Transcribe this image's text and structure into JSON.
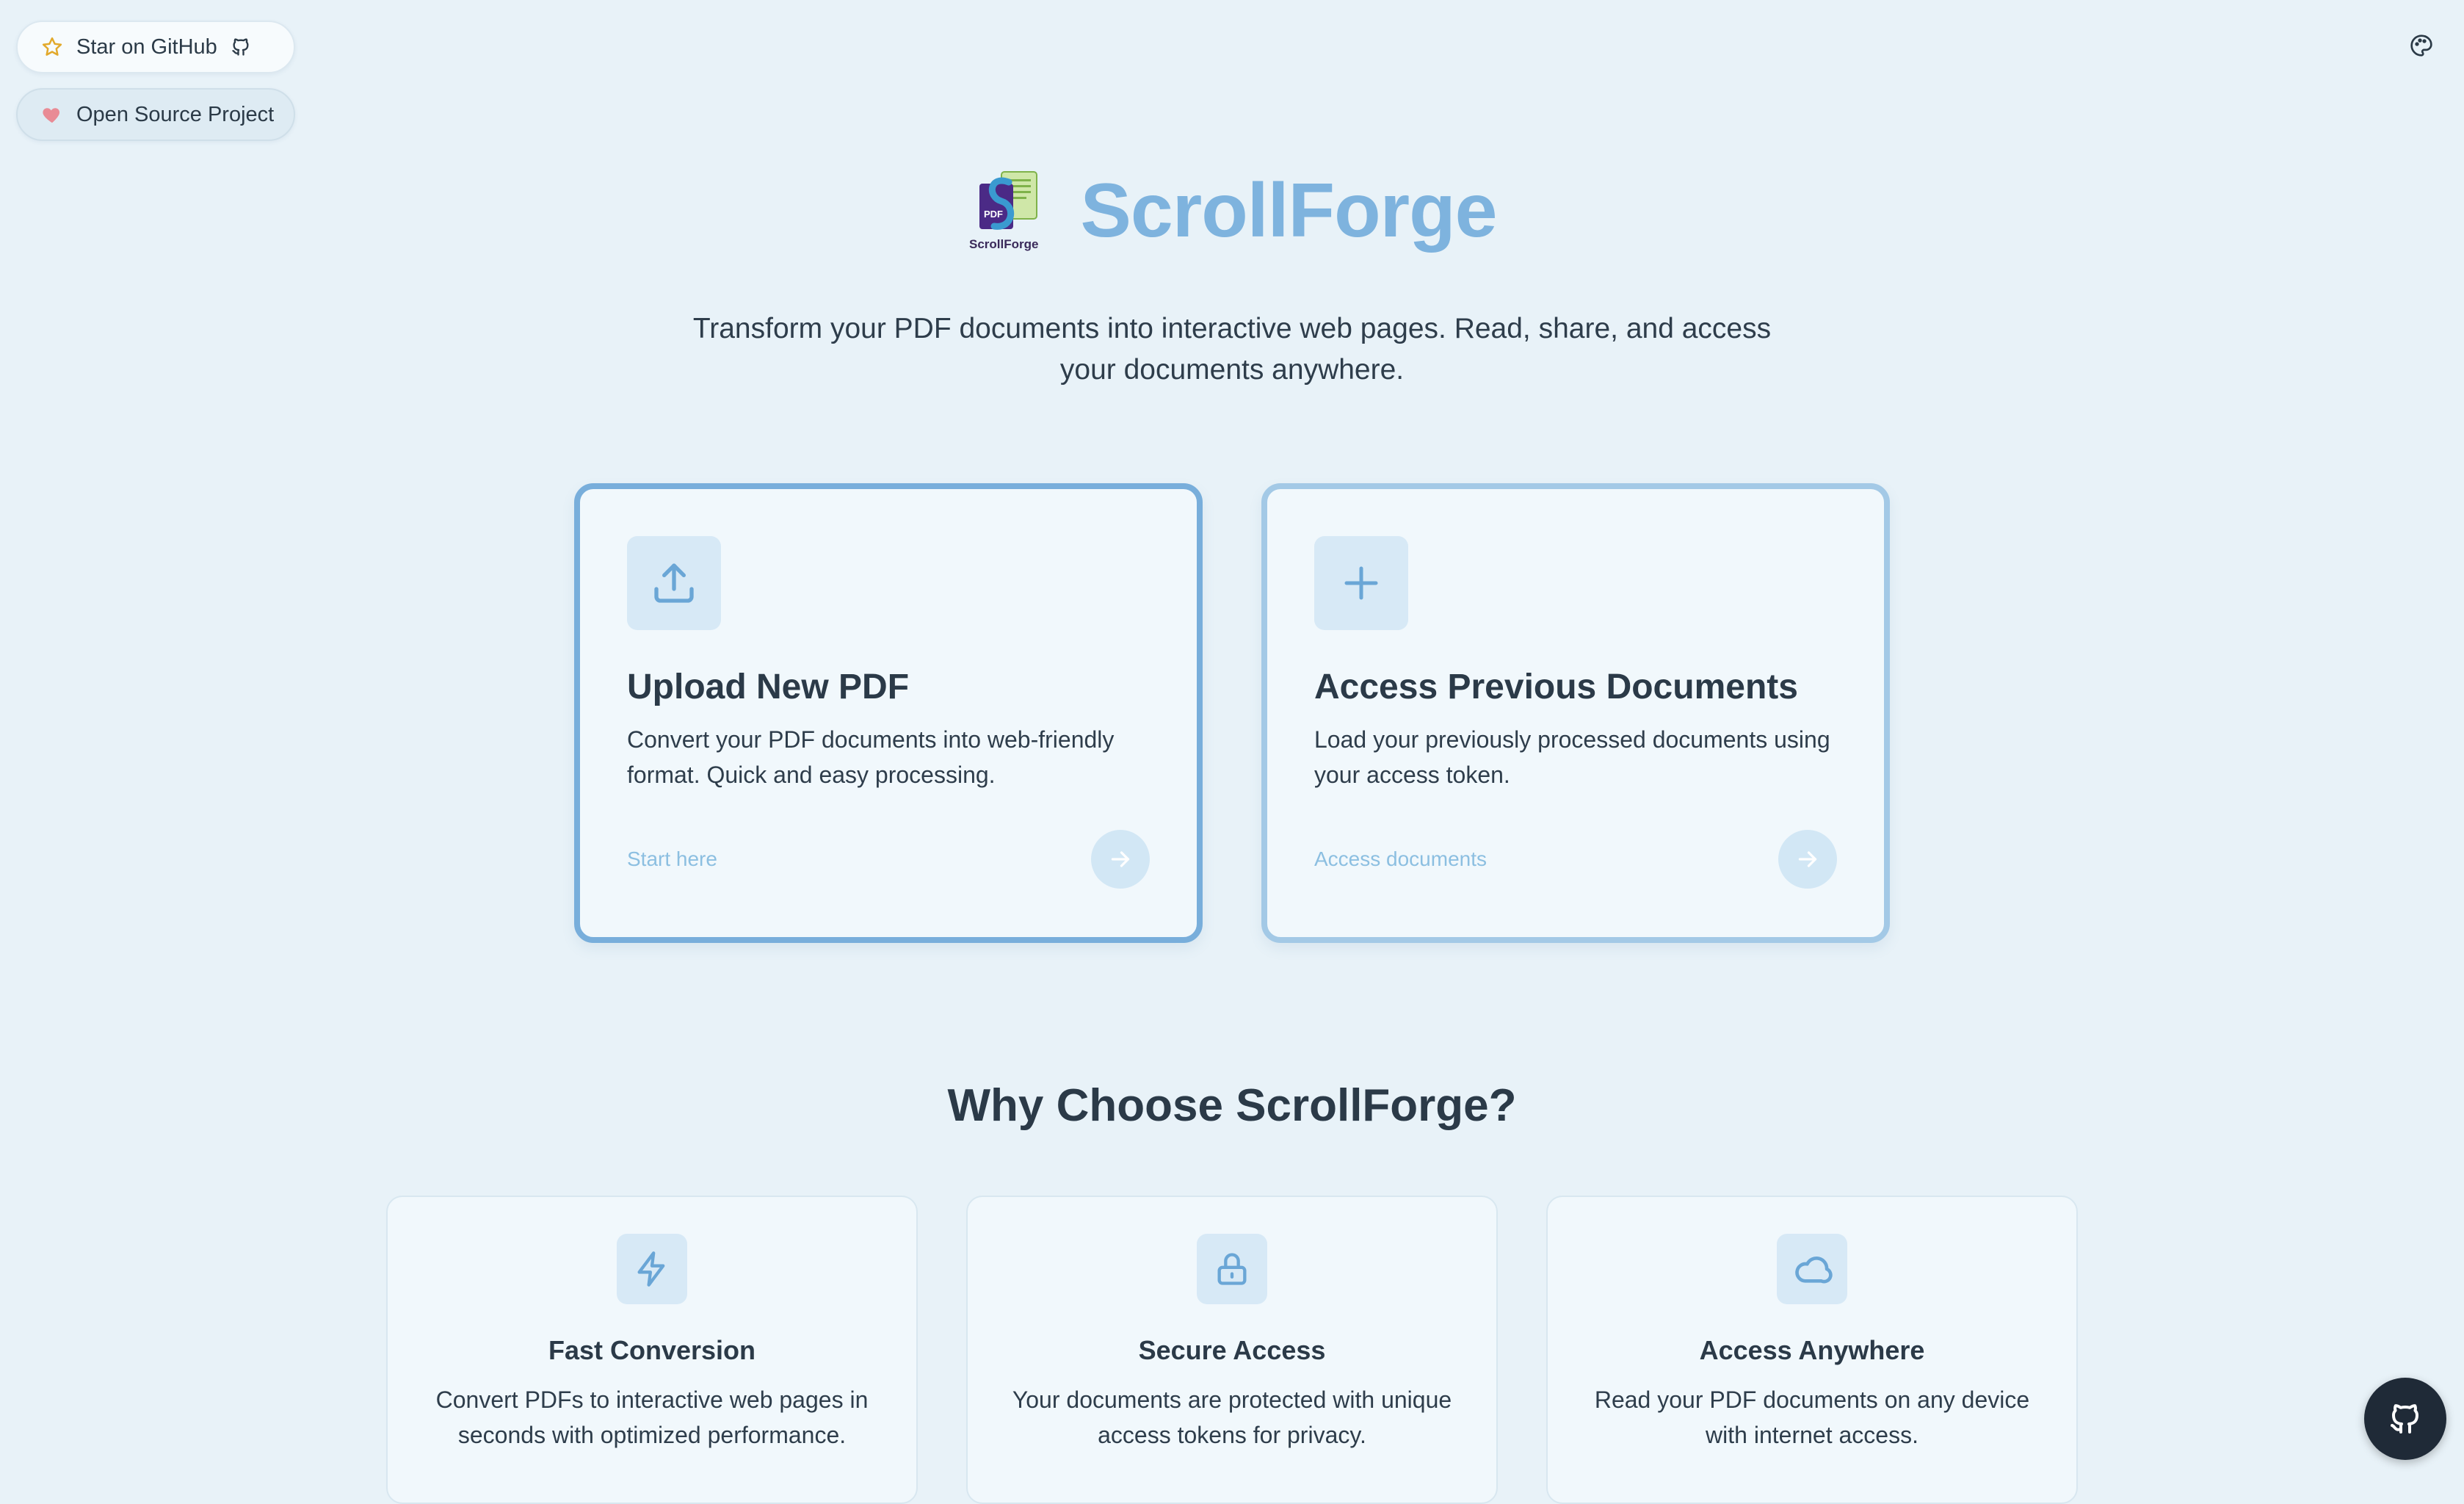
{
  "top_links": {
    "github_label": "Star on GitHub",
    "oss_label": "Open Source Project"
  },
  "header": {
    "app_name": "ScrollForge",
    "logo_text": "ScrollForge",
    "logo_badge": "PDF",
    "tagline": "Transform your PDF documents into interactive web pages. Read, share, and access your documents anywhere."
  },
  "actions": [
    {
      "title": "Upload New PDF",
      "description": "Convert your PDF documents into web-friendly format. Quick and easy processing.",
      "link": "Start here",
      "icon": "upload-icon"
    },
    {
      "title": "Access Previous Documents",
      "description": "Load your previously processed documents using your access token.",
      "link": "Access documents",
      "icon": "plus-icon"
    }
  ],
  "features_section": {
    "title": "Why Choose ScrollForge?",
    "items": [
      {
        "title": "Fast Conversion",
        "description": "Convert PDFs to interactive web pages in seconds with optimized performance.",
        "icon": "lightning-icon"
      },
      {
        "title": "Secure Access",
        "description": "Your documents are protected with unique access tokens for privacy.",
        "icon": "lock-icon"
      },
      {
        "title": "Access Anywhere",
        "description": "Read your PDF documents on any device with internet access.",
        "icon": "cloud-icon"
      }
    ]
  },
  "colors": {
    "background": "#e8f2f8",
    "accent": "#7eb3de",
    "card": "#f1f8fc",
    "text": "#2b3a48",
    "fab": "#1f2a37"
  }
}
